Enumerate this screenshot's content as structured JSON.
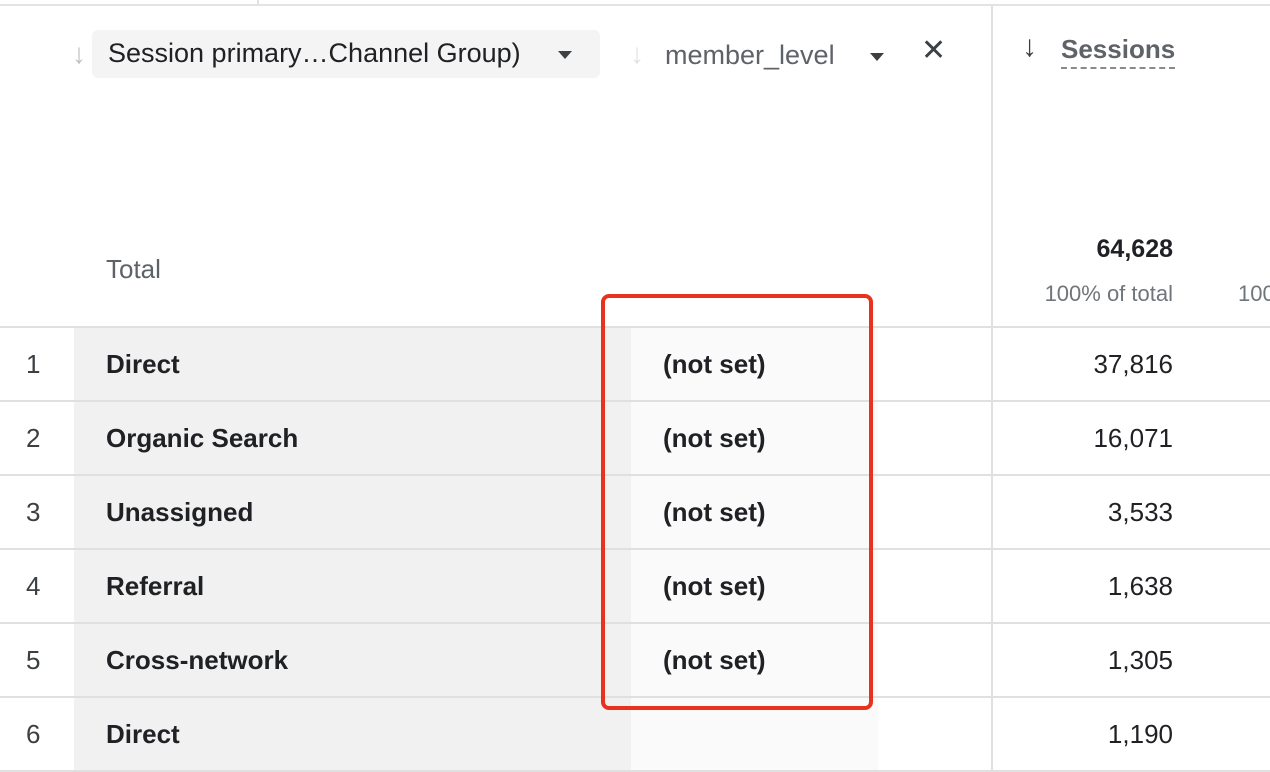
{
  "header": {
    "dimension_primary": "Session primary…Channel Group)",
    "dimension_secondary": "member_level",
    "metric": "Sessions"
  },
  "totals": {
    "label": "Total",
    "sessions": "64,628",
    "sessions_pct": "100% of total",
    "next_col_pct_partial": "100"
  },
  "rows": [
    {
      "index": "1",
      "channel": "Direct",
      "member_level": "(not set)",
      "sessions": "37,816"
    },
    {
      "index": "2",
      "channel": "Organic Search",
      "member_level": "(not set)",
      "sessions": "16,071"
    },
    {
      "index": "3",
      "channel": "Unassigned",
      "member_level": "(not set)",
      "sessions": "3,533"
    },
    {
      "index": "4",
      "channel": "Referral",
      "member_level": "(not set)",
      "sessions": "1,638"
    },
    {
      "index": "5",
      "channel": "Cross-network",
      "member_level": "(not set)",
      "sessions": "1,305"
    },
    {
      "index": "6",
      "channel": "Direct",
      "member_level": "",
      "sessions": "1,190"
    }
  ],
  "icons": {
    "sort": "arrow-down-icon",
    "dropdown": "caret-down-icon",
    "remove": "close-icon"
  },
  "colors": {
    "highlight": "#e8321e",
    "dim_cell_bg": "#f1f1f1"
  }
}
